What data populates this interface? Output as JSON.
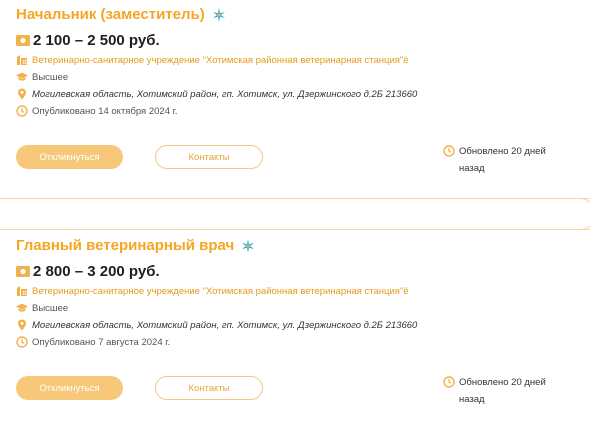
{
  "vacancies": [
    {
      "title": "Начальник (заместитель)",
      "salary": "2 100 – 2 500 руб.",
      "organization": "Ветеринарно-санитарное учреждение \"Хотимская районная ветеринарная станция\"ё",
      "education": "Высшее",
      "address": "Могилевская область, Хотимский район, гп. Хотимск, ул. Дзержинского д.2Б 213660",
      "published": "Опубликовано 14 октября 2024 г.",
      "apply_label": "Откликнуться",
      "contacts_label": "Контакты",
      "updated_line1": "Обновлено 20 дней",
      "updated_line2": "назад"
    },
    {
      "title": "Главный ветеринарный врач",
      "salary": "2 800 – 3 200 руб.",
      "organization": "Ветеринарно-санитарное учреждение \"Хотимская районная ветеринарная станция\"ё",
      "education": "Высшее",
      "address": "Могилевская область, Хотимский район, гп. Хотимск, ул. Дзержинского д.2Б 213660",
      "published": "Опубликовано 7 августа 2024 г.",
      "apply_label": "Откликнуться",
      "contacts_label": "Контакты",
      "updated_line1": "Обновлено 20 дней",
      "updated_line2": "назад"
    }
  ],
  "colors": {
    "accent": "#f5a623",
    "button_fill": "#f8c87a",
    "icon": "#f0b24d",
    "spark_blue": "#2aa7d8",
    "spark_gold": "#f5b82e"
  },
  "icons": {
    "salary": "money-icon",
    "organization": "building-icon",
    "education": "graduation-cap-icon",
    "address": "location-pin-icon",
    "published": "clock-icon",
    "updated": "clock-icon",
    "title_badge": "sparkle-icon"
  }
}
